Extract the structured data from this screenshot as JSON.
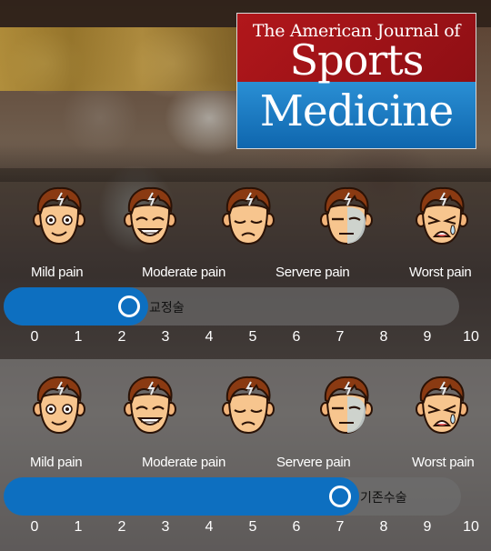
{
  "logo": {
    "line1": "The American Journal of",
    "line2": "Sports",
    "line3": "Medicine"
  },
  "scales": [
    {
      "faces": [
        "smile-face-icon",
        "grin-face-icon",
        "frown-face-icon",
        "pained-face-icon",
        "crying-face-icon"
      ],
      "labels": [
        "Mild pain",
        "Moderate pain",
        "Servere pain",
        "Worst pain"
      ],
      "slider_label": "교정술",
      "slider_value": 2,
      "ticks": [
        "0",
        "1",
        "2",
        "3",
        "4",
        "5",
        "6",
        "7",
        "8",
        "9",
        "10"
      ]
    },
    {
      "faces": [
        "smile-face-icon",
        "grin-face-icon",
        "frown-face-icon",
        "pained-face-icon",
        "crying-face-icon"
      ],
      "labels": [
        "Mild pain",
        "Moderate pain",
        "Servere pain",
        "Worst pain"
      ],
      "slider_label": "기존수술",
      "slider_value": 7,
      "ticks": [
        "0",
        "1",
        "2",
        "3",
        "4",
        "5",
        "6",
        "7",
        "8",
        "9",
        "10"
      ]
    }
  ],
  "colors": {
    "accent": "#0d6fc0",
    "logo_red": "#b1171b",
    "logo_blue": "#1e7fc6"
  }
}
